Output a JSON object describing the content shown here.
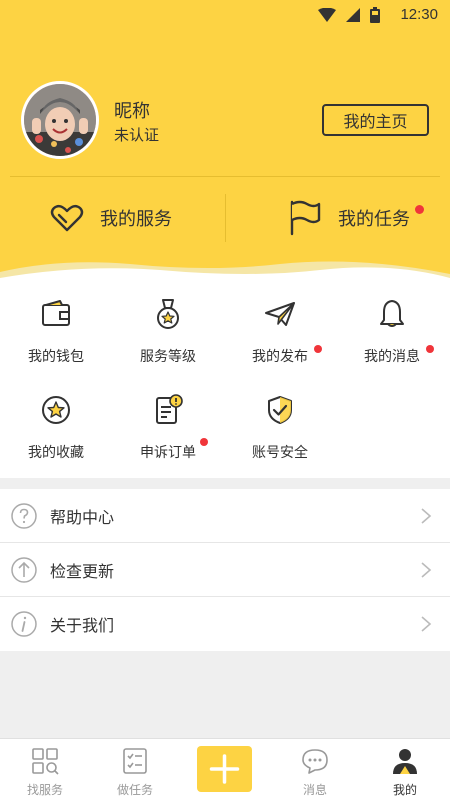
{
  "status_bar": {
    "time": "12:30"
  },
  "profile": {
    "nickname": "昵称",
    "verify_status": "未认证",
    "homepage_button": "我的主页"
  },
  "quick_actions": [
    {
      "label": "我的服务",
      "icon": "heart-icon",
      "badge": false
    },
    {
      "label": "我的任务",
      "icon": "flag-icon",
      "badge": true
    }
  ],
  "grid": [
    {
      "label": "我的钱包",
      "icon": "wallet-icon",
      "badge": false
    },
    {
      "label": "服务等级",
      "icon": "medal-icon",
      "badge": false
    },
    {
      "label": "我的发布",
      "icon": "paper-plane-icon",
      "badge": true
    },
    {
      "label": "我的消息",
      "icon": "bell-icon",
      "badge": true
    },
    {
      "label": "我的收藏",
      "icon": "star-icon",
      "badge": false
    },
    {
      "label": "申诉订单",
      "icon": "document-alert-icon",
      "badge": true
    },
    {
      "label": "账号安全",
      "icon": "shield-check-icon",
      "badge": false
    }
  ],
  "menu": [
    {
      "label": "帮助中心",
      "icon": "question-circle-icon"
    },
    {
      "label": "检查更新",
      "icon": "arrow-up-circle-icon"
    },
    {
      "label": "关于我们",
      "icon": "info-circle-icon"
    }
  ],
  "bottom_nav": [
    {
      "label": "找服务",
      "icon": "grid-search-icon",
      "active": false
    },
    {
      "label": "做任务",
      "icon": "checklist-icon",
      "active": false
    },
    {
      "label": "",
      "icon": "plus-icon",
      "active": false
    },
    {
      "label": "消息",
      "icon": "chat-bubble-icon",
      "active": false
    },
    {
      "label": "我的",
      "icon": "user-icon",
      "active": true
    }
  ],
  "colors": {
    "accent": "#fdd343",
    "badge": "#f0353a",
    "text": "#333333",
    "muted": "#999999"
  }
}
